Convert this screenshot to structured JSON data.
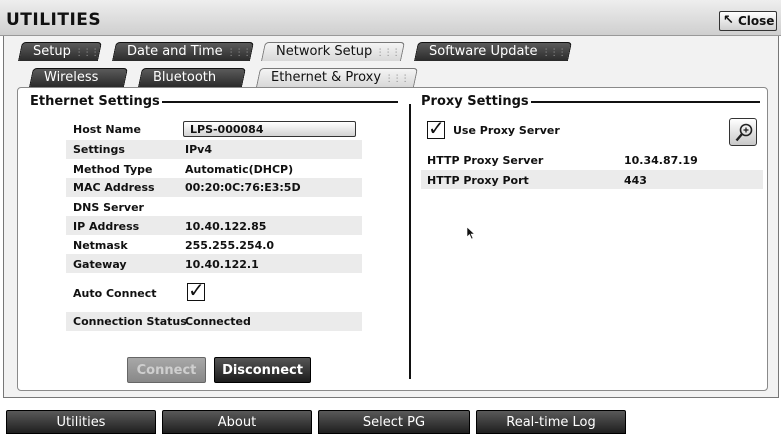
{
  "window": {
    "title": "UTILITIES",
    "close_label": "Close"
  },
  "tabs_main": [
    {
      "label": "Setup",
      "active": false
    },
    {
      "label": "Date and Time",
      "active": false
    },
    {
      "label": "Network Setup",
      "active": true
    },
    {
      "label": "Software Update",
      "active": false
    }
  ],
  "tabs_sub": [
    {
      "label": "Wireless",
      "active": false
    },
    {
      "label": "Bluetooth",
      "active": false
    },
    {
      "label": "Ethernet & Proxy",
      "active": true
    }
  ],
  "ethernet": {
    "title": "Ethernet Settings",
    "host_name_label": "Host Name",
    "host_name_value": "LPS-000084",
    "settings_label": "Settings",
    "settings_value": "IPv4",
    "method_label": "Method Type",
    "method_value": "Automatic(DHCP)",
    "mac_label": "MAC Address",
    "mac_value": "00:20:0C:76:E3:5D",
    "dns_label": "DNS Server",
    "dns_value": "",
    "ip_label": "IP Address",
    "ip_value": "10.40.122.85",
    "netmask_label": "Netmask",
    "netmask_value": "255.255.254.0",
    "gateway_label": "Gateway",
    "gateway_value": "10.40.122.1",
    "auto_connect_label": "Auto Connect",
    "auto_connect_checked": true,
    "status_label": "Connection Status",
    "status_value": "Connected",
    "connect_label": "Connect",
    "disconnect_label": "Disconnect"
  },
  "proxy": {
    "title": "Proxy Settings",
    "use_proxy_label": "Use Proxy Server",
    "use_proxy_checked": true,
    "server_label": "HTTP Proxy Server",
    "server_value": "10.34.87.19",
    "port_label": "HTTP Proxy Port",
    "port_value": "443"
  },
  "bottom_nav": [
    "Utilities",
    "About",
    "Select PG",
    "Real-time Log"
  ],
  "icons": {
    "close": "close-arrow-icon",
    "grip": "grip-dots-icon",
    "check": "checkmark-icon",
    "zoom": "magnifier-plus-icon",
    "cursor": "mouse-pointer-icon"
  }
}
